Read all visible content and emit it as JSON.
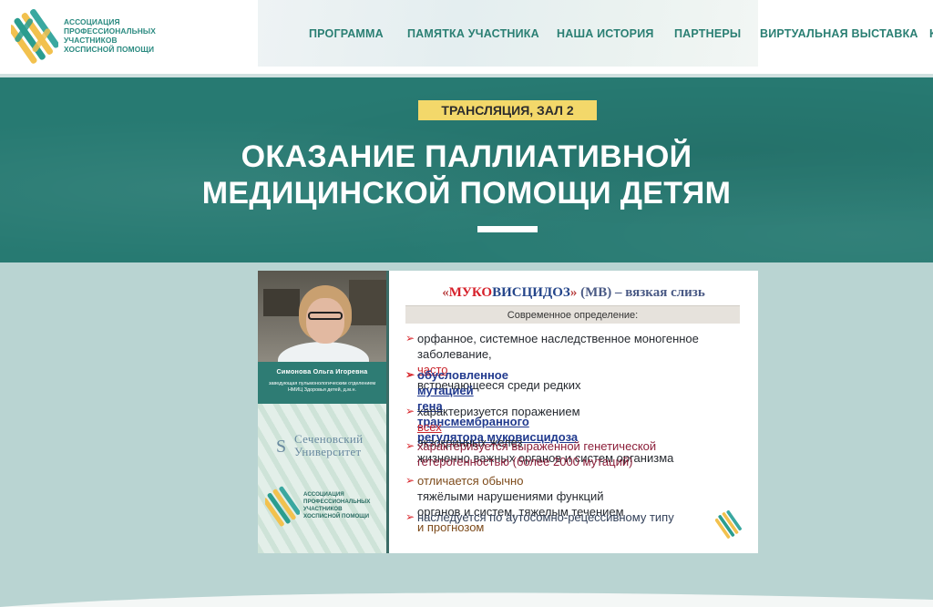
{
  "header": {
    "logo": {
      "lines": [
        "Ассоциация",
        "профессиональных",
        "участников",
        "хосписной помощи"
      ],
      "colors": [
        "#2a9d8f",
        "#f2c14e",
        "#3aa8a0"
      ]
    },
    "nav": [
      {
        "label": "ПРОГРАММА"
      },
      {
        "label": "ПАМЯТКА УЧАСТНИКА"
      },
      {
        "label": "НАША ИСТОРИЯ"
      },
      {
        "label": "ПАРТНЕРЫ"
      },
      {
        "label": "ВИРТУАЛЬНАЯ ВЫСТАВКА"
      },
      {
        "label": "К"
      }
    ]
  },
  "hero": {
    "badge": "ТРАНСЛЯЦИЯ, ЗАЛ 2",
    "title_lines": [
      "ОКАЗАНИЕ ПАЛЛИАТИВНОЙ",
      "МЕДИЦИНСКОЙ ПОМОЩИ ДЕТЯМ"
    ],
    "bg_color": "#277a72",
    "badge_color": "#f3d86a"
  },
  "video": {
    "speaker_name": "Симонова Ольга Игоревна",
    "speaker_position": "заведующая пульмонологическим отделением НМИЦ Здоровья детей, д.м.н.",
    "university": {
      "letter": "S",
      "lines": [
        "Сеченовский",
        "Университет"
      ]
    },
    "promo_logo_lines": [
      "Ассоциация",
      "профессиональных",
      "участников",
      "хосписной помощи"
    ],
    "slide": {
      "title": {
        "q_open": "«",
        "red": "МУКО",
        "blue": "ВИСЦИДОЗ",
        "q_close": "»",
        "rest": " (МВ) – вязкая слизь"
      },
      "definition": "Современное определение:",
      "bullets": [
        {
          "lines": [
            "орфанное, системное наследственное моногенное",
            "заболевание, "
          ],
          "emph": "часто",
          "tail": " встречающееся среди редких"
        },
        {
          "pre": "обусловленное ",
          "u1": "мутацией",
          "mid": " ",
          "u2": "гена",
          "mid2": " ",
          "u3": "трансмембранного",
          "line2": "регулятора муковисцидоза"
        },
        {
          "pre": "характеризуется поражением ",
          "emph": "всех",
          "tail": " экзокринных желез",
          "line2": "жизненно важных органов и систем организма"
        },
        {
          "lines": [
            "характеризуется выраженной генетической",
            "гетерогенностью (более 2000 мутаций)"
          ]
        },
        {
          "pre": "отличается обычно ",
          "tail": "тяжёлыми нарушениями функций",
          "line2a": "органов и систем, тяжелым течением ",
          "line2b": "и прогнозом"
        },
        {
          "lines": [
            "наследуется по аутосомно-рецессивному типу"
          ]
        }
      ]
    }
  }
}
